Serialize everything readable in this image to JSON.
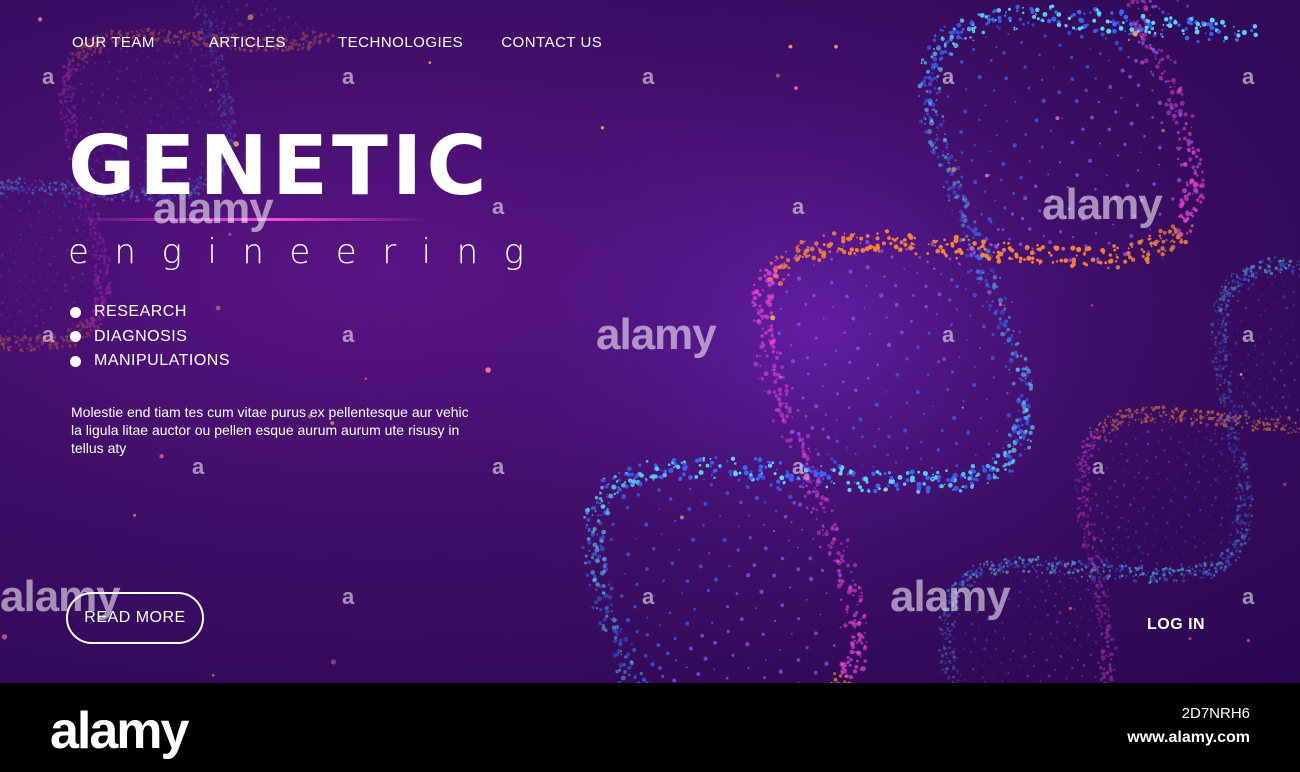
{
  "nav": {
    "items": [
      "OUR TEAM",
      "ARTICLES",
      "TECHNOLOGIES",
      "CONTACT US"
    ]
  },
  "hero": {
    "title": "GENETIC",
    "subtitle": "engineering",
    "bullets": [
      "RESEARCH",
      "DIAGNOSIS",
      "MANIPULATIONS"
    ],
    "description": "Molestie end tiam tes cum vitae purus ex pellentesque aur vehic la ligula litae auctor ou pellen esque aurum aurum ute risusy in tellus aty",
    "cta_label": "READ MORE",
    "login_label": "LOG IN"
  },
  "watermark": {
    "text": "alamy",
    "letter": "a"
  },
  "footer": {
    "brand": "alamy",
    "image_id": "2D7NRH6",
    "site": "www.alamy.com"
  },
  "colors": {
    "background": "#3e0d66",
    "helix_blue": "#3a6bff",
    "helix_cyan": "#5fe0ff",
    "helix_orange": "#ff8a3a",
    "helix_pink": "#ff4ae0"
  }
}
